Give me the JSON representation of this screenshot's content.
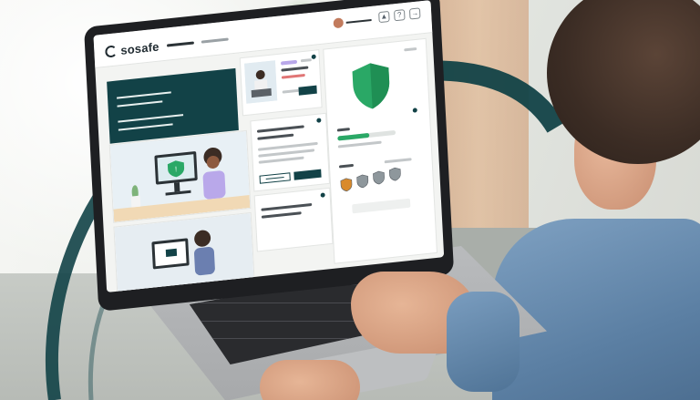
{
  "brand": {
    "logo_text": "sosafe",
    "accent_dark_teal": "#124247",
    "accent_green": "#2aa866",
    "accent_purple": "#b9a8ea"
  },
  "scene": {
    "description_tag": "laptop-dashboard-photo",
    "icons": [
      "logo-mark-icon",
      "thumbs-up-icon",
      "help-icon",
      "logout-icon",
      "shield-icon",
      "award-badge-icon"
    ]
  },
  "dashboard": {
    "learning_progress": 0.55,
    "awarded_badges_count": 4
  }
}
